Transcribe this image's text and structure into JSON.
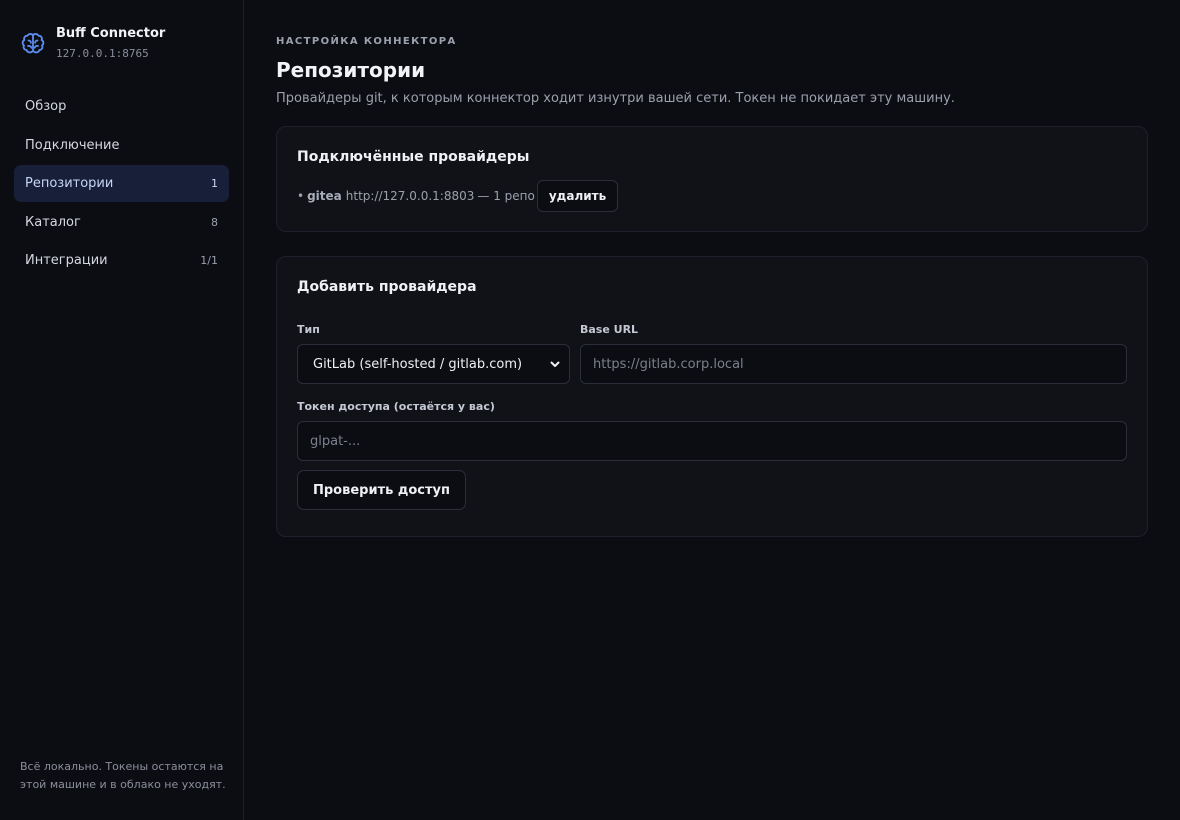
{
  "brand": {
    "name": "Buff Connector",
    "address": "127.0.0.1:8765",
    "accent": "#5b8def"
  },
  "nav": [
    {
      "label": "Обзор",
      "count": ""
    },
    {
      "label": "Подключение",
      "count": ""
    },
    {
      "label": "Репозитории",
      "count": "1",
      "active": true
    },
    {
      "label": "Каталог",
      "count": "8"
    },
    {
      "label": "Интеграции",
      "count": "1/1"
    }
  ],
  "sidebar_footer": "Всё локально. Токены остаются на этой машине и в облако не уходят.",
  "header": {
    "eyebrow": "НАСТРОЙКА КОННЕКТОРА",
    "title": "Репозитории",
    "description": "Провайдеры git, к которым коннектор ходит изнутри вашей сети. Токен не покидает эту машину."
  },
  "connected": {
    "title": "Подключённые провайдеры",
    "providers": [
      {
        "bullet": "•",
        "name": "gitea",
        "url": "http://127.0.0.1:8803",
        "info": "— 1 репо",
        "remove_label": "удалить"
      }
    ]
  },
  "add_provider": {
    "title": "Добавить провайдера",
    "type_label": "Тип",
    "type_value": "GitLab (self-hosted / gitlab.com)",
    "base_url_label": "Base URL",
    "base_url_placeholder": "https://gitlab.corp.local",
    "token_label": "Токен доступа (остаётся у вас)",
    "token_placeholder": "glpat-...",
    "check_button": "Проверить доступ"
  }
}
